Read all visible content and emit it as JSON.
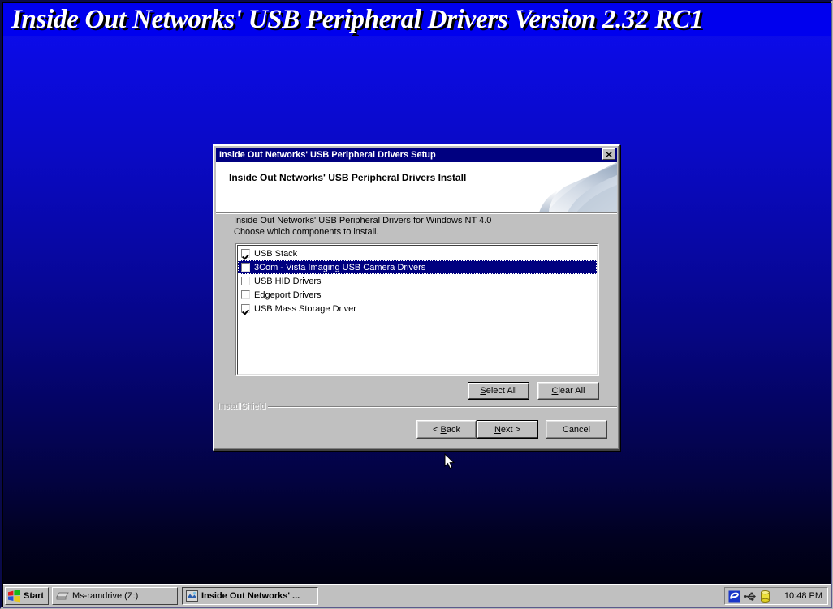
{
  "desktop": {
    "banner_title": "Inside Out Networks' USB Peripheral Drivers Version 2.32 RC1",
    "background_top_color": "#0c0cf4",
    "background_bottom_color": "#000010",
    "banner_color": "#0000ee"
  },
  "dialog": {
    "titlebar": {
      "title": "Inside Out Networks' USB Peripheral Drivers Setup",
      "title_color": "#000080",
      "close_label": "×"
    },
    "header": {
      "heading": "Inside Out Networks' USB Peripheral Drivers Install"
    },
    "body": {
      "instruction_line1": "Inside Out Networks' USB Peripheral Drivers for Windows NT 4.0",
      "instruction_line2": "Choose which components to install.",
      "components": [
        {
          "label": "USB Stack",
          "checked": true,
          "selected": false
        },
        {
          "label": "3Com - Vista Imaging USB Camera Drivers",
          "checked": false,
          "selected": true
        },
        {
          "label": "USB HID Drivers",
          "checked": false,
          "selected": false
        },
        {
          "label": "Edgeport Drivers",
          "checked": false,
          "selected": false
        },
        {
          "label": "USB Mass Storage Driver",
          "checked": true,
          "selected": false
        }
      ]
    },
    "buttons": {
      "select_all": {
        "prefix": "",
        "accel": "S",
        "suffix": "elect All"
      },
      "clear_all": {
        "prefix": "",
        "accel": "C",
        "suffix": "lear All"
      },
      "back": {
        "prefix": "< ",
        "accel": "B",
        "suffix": "ack"
      },
      "next": {
        "prefix": "",
        "accel": "N",
        "suffix": "ext >"
      },
      "cancel": {
        "prefix": "",
        "accel": "",
        "suffix": "Cancel"
      }
    },
    "footer": {
      "brand": "InstallShield"
    }
  },
  "taskbar": {
    "start_label": "Start",
    "tasks": [
      {
        "label": "Ms-ramdrive (Z:)",
        "active": false
      },
      {
        "label": "Inside Out Networks' ...",
        "active": true
      }
    ],
    "tray": {
      "icons": [
        "internet-explorer-icon",
        "usb-device-icon",
        "removable-drive-icon"
      ],
      "clock": "10:48 PM"
    }
  }
}
